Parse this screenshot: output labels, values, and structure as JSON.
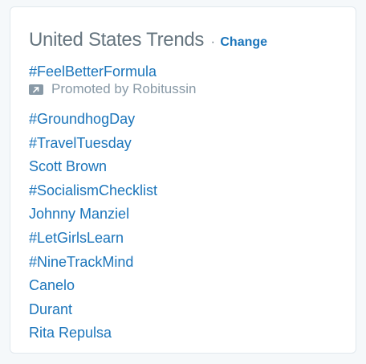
{
  "trends_module": {
    "title": "United States Trends",
    "separator": "·",
    "change_label": "Change",
    "promoted": {
      "trend": "#FeelBetterFormula",
      "label": "Promoted by Robitussin",
      "icon": "promoted-arrow-icon"
    },
    "trends": [
      "#GroundhogDay",
      "#TravelTuesday",
      "Scott Brown",
      "#SocialismChecklist",
      "Johnny Manziel",
      "#LetGirlsLearn",
      "#NineTrackMind",
      "Canelo",
      "Durant",
      "Rita Repulsa"
    ]
  },
  "colors": {
    "link": "#1b75bb",
    "title": "#66757f",
    "muted": "#8899a6",
    "background": "#f5f8fa",
    "panel": "#ffffff",
    "border": "#e1e8ed"
  }
}
